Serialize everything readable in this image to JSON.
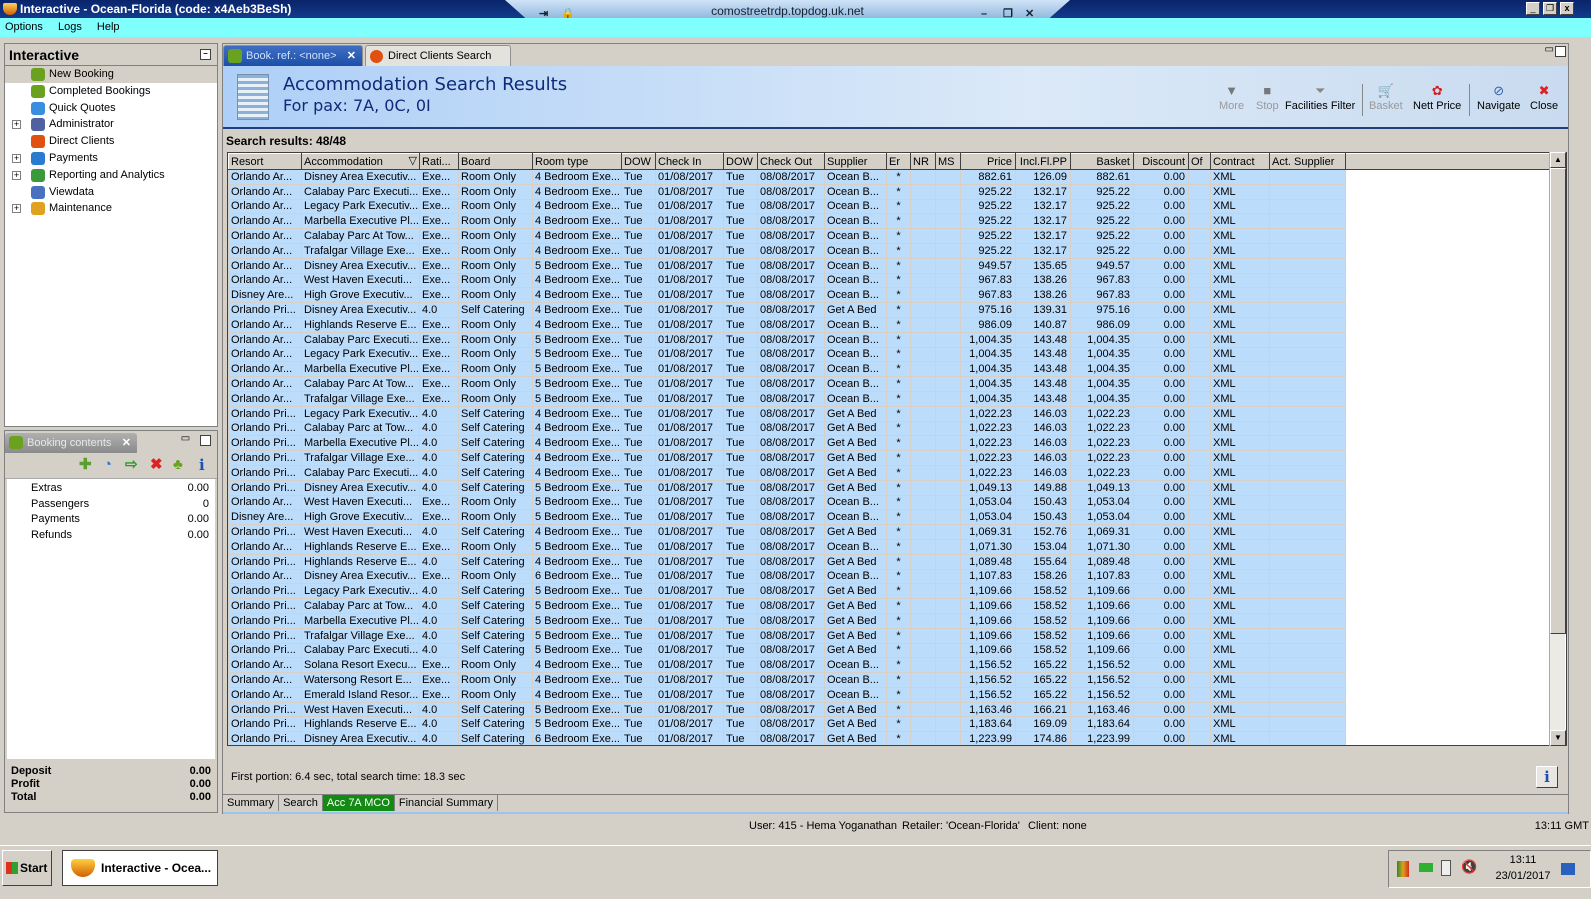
{
  "window": {
    "title": "Interactive - Ocean-Florida (code: x4Aeb3BeSh)",
    "rdp_host": "comostreetrdp.topdog.uk.net"
  },
  "menu": [
    "Options",
    "Logs",
    "Help"
  ],
  "nav": {
    "title": "Interactive",
    "items": [
      {
        "label": "New Booking",
        "expandable": false,
        "icon": "palm-tree-icon",
        "color": "#6aa220"
      },
      {
        "label": "Completed Bookings",
        "expandable": false,
        "icon": "palm-money-icon",
        "color": "#6aa220"
      },
      {
        "label": "Quick Quotes",
        "expandable": false,
        "icon": "clock-icon",
        "color": "#3a8ee0"
      },
      {
        "label": "Administrator",
        "expandable": true,
        "icon": "runner-icon",
        "color": "#5060a0"
      },
      {
        "label": "Direct Clients",
        "expandable": false,
        "icon": "client-icon",
        "color": "#e05010"
      },
      {
        "label": "Payments",
        "expandable": true,
        "icon": "payment-icon",
        "color": "#2a7ad0"
      },
      {
        "label": "Reporting and Analytics",
        "expandable": true,
        "icon": "report-icon",
        "color": "#3a9a3a"
      },
      {
        "label": "Viewdata",
        "expandable": false,
        "icon": "globe-icon",
        "color": "#4a70c0"
      },
      {
        "label": "Maintenance",
        "expandable": true,
        "icon": "maintenance-icon",
        "color": "#e0a020"
      }
    ]
  },
  "booking_contents": {
    "title": "Booking contents",
    "rows": [
      {
        "label": "Extras",
        "value": "0.00"
      },
      {
        "label": "Passengers",
        "value": "0"
      },
      {
        "label": "Payments",
        "value": "0.00"
      },
      {
        "label": "Refunds",
        "value": "0.00"
      }
    ],
    "totals": [
      {
        "label": "Deposit",
        "value": "0.00"
      },
      {
        "label": "Profit",
        "value": "0.00"
      },
      {
        "label": "Total",
        "value": "0.00"
      }
    ]
  },
  "tabs": [
    {
      "label": "Book. ref.: <none>"
    },
    {
      "label": "Direct Clients Search"
    }
  ],
  "header": {
    "title": "Accommodation Search Results",
    "subtitle": "For pax: 7A, 0C, 0I"
  },
  "toolbar": [
    {
      "label": "More",
      "icon": "more-icon",
      "glyph": "▼",
      "disabled": true
    },
    {
      "label": "Stop",
      "icon": "stop-icon",
      "glyph": "■",
      "disabled": true
    },
    {
      "label": "Facilities Filter",
      "icon": "funnel-icon",
      "glyph": "⏷",
      "disabled": false
    },
    {
      "label": "Basket",
      "icon": "basket-icon",
      "glyph": "🛒",
      "disabled": true
    },
    {
      "label": "Nett Price",
      "icon": "nett-price-icon",
      "glyph": "✿",
      "disabled": false
    },
    {
      "label": "Navigate",
      "icon": "compass-icon",
      "glyph": "⊘",
      "disabled": false
    },
    {
      "label": "Close",
      "icon": "close-icon",
      "glyph": "✖",
      "disabled": false
    }
  ],
  "search_results": "Search results: 48/48",
  "grid": {
    "columns": [
      "Resort",
      "Accommodation",
      "Rati...",
      "Board",
      "Room type",
      "DOW",
      "Check In",
      "DOW",
      "Check Out",
      "Supplier",
      "Er",
      "NR",
      "MS",
      "Price",
      "Incl.Fl.PP",
      "Basket",
      "Discount",
      "Of",
      "Contract",
      "Act. Supplier"
    ],
    "rows": [
      [
        "Orlando Ar...",
        "Disney Area Executiv...",
        "Exe...",
        "Room Only",
        "4 Bedroom Exe...",
        "Tue",
        "01/08/2017",
        "Tue",
        "08/08/2017",
        "Ocean B...",
        "*",
        "",
        "",
        "882.61",
        "126.09",
        "882.61",
        "0.00",
        "",
        "XML",
        ""
      ],
      [
        "Orlando Ar...",
        "Calabay Parc Executi...",
        "Exe...",
        "Room Only",
        "4 Bedroom Exe...",
        "Tue",
        "01/08/2017",
        "Tue",
        "08/08/2017",
        "Ocean B...",
        "*",
        "",
        "",
        "925.22",
        "132.17",
        "925.22",
        "0.00",
        "",
        "XML",
        ""
      ],
      [
        "Orlando Ar...",
        "Legacy Park Executiv...",
        "Exe...",
        "Room Only",
        "4 Bedroom Exe...",
        "Tue",
        "01/08/2017",
        "Tue",
        "08/08/2017",
        "Ocean B...",
        "*",
        "",
        "",
        "925.22",
        "132.17",
        "925.22",
        "0.00",
        "",
        "XML",
        ""
      ],
      [
        "Orlando Ar...",
        "Marbella Executive Pl...",
        "Exe...",
        "Room Only",
        "4 Bedroom Exe...",
        "Tue",
        "01/08/2017",
        "Tue",
        "08/08/2017",
        "Ocean B...",
        "*",
        "",
        "",
        "925.22",
        "132.17",
        "925.22",
        "0.00",
        "",
        "XML",
        ""
      ],
      [
        "Orlando Ar...",
        "Calabay Parc At Tow...",
        "Exe...",
        "Room Only",
        "4 Bedroom Exe...",
        "Tue",
        "01/08/2017",
        "Tue",
        "08/08/2017",
        "Ocean B...",
        "*",
        "",
        "",
        "925.22",
        "132.17",
        "925.22",
        "0.00",
        "",
        "XML",
        ""
      ],
      [
        "Orlando Ar...",
        "Trafalgar Village Exe...",
        "Exe...",
        "Room Only",
        "4 Bedroom Exe...",
        "Tue",
        "01/08/2017",
        "Tue",
        "08/08/2017",
        "Ocean B...",
        "*",
        "",
        "",
        "925.22",
        "132.17",
        "925.22",
        "0.00",
        "",
        "XML",
        ""
      ],
      [
        "Orlando Ar...",
        "Disney Area Executiv...",
        "Exe...",
        "Room Only",
        "5 Bedroom Exe...",
        "Tue",
        "01/08/2017",
        "Tue",
        "08/08/2017",
        "Ocean B...",
        "*",
        "",
        "",
        "949.57",
        "135.65",
        "949.57",
        "0.00",
        "",
        "XML",
        ""
      ],
      [
        "Orlando Ar...",
        "West Haven Executi...",
        "Exe...",
        "Room Only",
        "4 Bedroom Exe...",
        "Tue",
        "01/08/2017",
        "Tue",
        "08/08/2017",
        "Ocean B...",
        "*",
        "",
        "",
        "967.83",
        "138.26",
        "967.83",
        "0.00",
        "",
        "XML",
        ""
      ],
      [
        "Disney Are...",
        "High Grove Executiv...",
        "Exe...",
        "Room Only",
        "4 Bedroom Exe...",
        "Tue",
        "01/08/2017",
        "Tue",
        "08/08/2017",
        "Ocean B...",
        "*",
        "",
        "",
        "967.83",
        "138.26",
        "967.83",
        "0.00",
        "",
        "XML",
        ""
      ],
      [
        "Orlando Pri...",
        "Disney Area Executiv...",
        "4.0",
        "Self Catering",
        "4 Bedroom Exe...",
        "Tue",
        "01/08/2017",
        "Tue",
        "08/08/2017",
        "Get A Bed",
        "*",
        "",
        "",
        "975.16",
        "139.31",
        "975.16",
        "0.00",
        "",
        "XML",
        ""
      ],
      [
        "Orlando Ar...",
        "Highlands Reserve E...",
        "Exe...",
        "Room Only",
        "4 Bedroom Exe...",
        "Tue",
        "01/08/2017",
        "Tue",
        "08/08/2017",
        "Ocean B...",
        "*",
        "",
        "",
        "986.09",
        "140.87",
        "986.09",
        "0.00",
        "",
        "XML",
        ""
      ],
      [
        "Orlando Ar...",
        "Calabay Parc Executi...",
        "Exe...",
        "Room Only",
        "5 Bedroom Exe...",
        "Tue",
        "01/08/2017",
        "Tue",
        "08/08/2017",
        "Ocean B...",
        "*",
        "",
        "",
        "1,004.35",
        "143.48",
        "1,004.35",
        "0.00",
        "",
        "XML",
        ""
      ],
      [
        "Orlando Ar...",
        "Legacy Park Executiv...",
        "Exe...",
        "Room Only",
        "5 Bedroom Exe...",
        "Tue",
        "01/08/2017",
        "Tue",
        "08/08/2017",
        "Ocean B...",
        "*",
        "",
        "",
        "1,004.35",
        "143.48",
        "1,004.35",
        "0.00",
        "",
        "XML",
        ""
      ],
      [
        "Orlando Ar...",
        "Marbella Executive Pl...",
        "Exe...",
        "Room Only",
        "5 Bedroom Exe...",
        "Tue",
        "01/08/2017",
        "Tue",
        "08/08/2017",
        "Ocean B...",
        "*",
        "",
        "",
        "1,004.35",
        "143.48",
        "1,004.35",
        "0.00",
        "",
        "XML",
        ""
      ],
      [
        "Orlando Ar...",
        "Calabay Parc At Tow...",
        "Exe...",
        "Room Only",
        "5 Bedroom Exe...",
        "Tue",
        "01/08/2017",
        "Tue",
        "08/08/2017",
        "Ocean B...",
        "*",
        "",
        "",
        "1,004.35",
        "143.48",
        "1,004.35",
        "0.00",
        "",
        "XML",
        ""
      ],
      [
        "Orlando Ar...",
        "Trafalgar Village Exe...",
        "Exe...",
        "Room Only",
        "5 Bedroom Exe...",
        "Tue",
        "01/08/2017",
        "Tue",
        "08/08/2017",
        "Ocean B...",
        "*",
        "",
        "",
        "1,004.35",
        "143.48",
        "1,004.35",
        "0.00",
        "",
        "XML",
        ""
      ],
      [
        "Orlando Pri...",
        "Legacy Park Executiv...",
        "4.0",
        "Self Catering",
        "4 Bedroom Exe...",
        "Tue",
        "01/08/2017",
        "Tue",
        "08/08/2017",
        "Get A Bed",
        "*",
        "",
        "",
        "1,022.23",
        "146.03",
        "1,022.23",
        "0.00",
        "",
        "XML",
        ""
      ],
      [
        "Orlando Pri...",
        "Calabay Parc at Tow...",
        "4.0",
        "Self Catering",
        "4 Bedroom Exe...",
        "Tue",
        "01/08/2017",
        "Tue",
        "08/08/2017",
        "Get A Bed",
        "*",
        "",
        "",
        "1,022.23",
        "146.03",
        "1,022.23",
        "0.00",
        "",
        "XML",
        ""
      ],
      [
        "Orlando Pri...",
        "Marbella Executive Pl...",
        "4.0",
        "Self Catering",
        "4 Bedroom Exe...",
        "Tue",
        "01/08/2017",
        "Tue",
        "08/08/2017",
        "Get A Bed",
        "*",
        "",
        "",
        "1,022.23",
        "146.03",
        "1,022.23",
        "0.00",
        "",
        "XML",
        ""
      ],
      [
        "Orlando Pri...",
        "Trafalgar Village Exe...",
        "4.0",
        "Self Catering",
        "4 Bedroom Exe...",
        "Tue",
        "01/08/2017",
        "Tue",
        "08/08/2017",
        "Get A Bed",
        "*",
        "",
        "",
        "1,022.23",
        "146.03",
        "1,022.23",
        "0.00",
        "",
        "XML",
        ""
      ],
      [
        "Orlando Pri...",
        "Calabay Parc Executi...",
        "4.0",
        "Self Catering",
        "4 Bedroom Exe...",
        "Tue",
        "01/08/2017",
        "Tue",
        "08/08/2017",
        "Get A Bed",
        "*",
        "",
        "",
        "1,022.23",
        "146.03",
        "1,022.23",
        "0.00",
        "",
        "XML",
        ""
      ],
      [
        "Orlando Pri...",
        "Disney Area Executiv...",
        "4.0",
        "Self Catering",
        "5 Bedroom Exe...",
        "Tue",
        "01/08/2017",
        "Tue",
        "08/08/2017",
        "Get A Bed",
        "*",
        "",
        "",
        "1,049.13",
        "149.88",
        "1,049.13",
        "0.00",
        "",
        "XML",
        ""
      ],
      [
        "Orlando Ar...",
        "West Haven Executi...",
        "Exe...",
        "Room Only",
        "5 Bedroom Exe...",
        "Tue",
        "01/08/2017",
        "Tue",
        "08/08/2017",
        "Ocean B...",
        "*",
        "",
        "",
        "1,053.04",
        "150.43",
        "1,053.04",
        "0.00",
        "",
        "XML",
        ""
      ],
      [
        "Disney Are...",
        "High Grove Executiv...",
        "Exe...",
        "Room Only",
        "5 Bedroom Exe...",
        "Tue",
        "01/08/2017",
        "Tue",
        "08/08/2017",
        "Ocean B...",
        "*",
        "",
        "",
        "1,053.04",
        "150.43",
        "1,053.04",
        "0.00",
        "",
        "XML",
        ""
      ],
      [
        "Orlando Pri...",
        "West Haven Executi...",
        "4.0",
        "Self Catering",
        "4 Bedroom Exe...",
        "Tue",
        "01/08/2017",
        "Tue",
        "08/08/2017",
        "Get A Bed",
        "*",
        "",
        "",
        "1,069.31",
        "152.76",
        "1,069.31",
        "0.00",
        "",
        "XML",
        ""
      ],
      [
        "Orlando Ar...",
        "Highlands Reserve E...",
        "Exe...",
        "Room Only",
        "5 Bedroom Exe...",
        "Tue",
        "01/08/2017",
        "Tue",
        "08/08/2017",
        "Ocean B...",
        "*",
        "",
        "",
        "1,071.30",
        "153.04",
        "1,071.30",
        "0.00",
        "",
        "XML",
        ""
      ],
      [
        "Orlando Pri...",
        "Highlands Reserve E...",
        "4.0",
        "Self Catering",
        "4 Bedroom Exe...",
        "Tue",
        "01/08/2017",
        "Tue",
        "08/08/2017",
        "Get A Bed",
        "*",
        "",
        "",
        "1,089.48",
        "155.64",
        "1,089.48",
        "0.00",
        "",
        "XML",
        ""
      ],
      [
        "Orlando Ar...",
        "Disney Area Executiv...",
        "Exe...",
        "Room Only",
        "6 Bedroom Exe...",
        "Tue",
        "01/08/2017",
        "Tue",
        "08/08/2017",
        "Ocean B...",
        "*",
        "",
        "",
        "1,107.83",
        "158.26",
        "1,107.83",
        "0.00",
        "",
        "XML",
        ""
      ],
      [
        "Orlando Pri...",
        "Legacy Park Executiv...",
        "4.0",
        "Self Catering",
        "5 Bedroom Exe...",
        "Tue",
        "01/08/2017",
        "Tue",
        "08/08/2017",
        "Get A Bed",
        "*",
        "",
        "",
        "1,109.66",
        "158.52",
        "1,109.66",
        "0.00",
        "",
        "XML",
        ""
      ],
      [
        "Orlando Pri...",
        "Calabay Parc at Tow...",
        "4.0",
        "Self Catering",
        "5 Bedroom Exe...",
        "Tue",
        "01/08/2017",
        "Tue",
        "08/08/2017",
        "Get A Bed",
        "*",
        "",
        "",
        "1,109.66",
        "158.52",
        "1,109.66",
        "0.00",
        "",
        "XML",
        ""
      ],
      [
        "Orlando Pri...",
        "Marbella Executive Pl...",
        "4.0",
        "Self Catering",
        "5 Bedroom Exe...",
        "Tue",
        "01/08/2017",
        "Tue",
        "08/08/2017",
        "Get A Bed",
        "*",
        "",
        "",
        "1,109.66",
        "158.52",
        "1,109.66",
        "0.00",
        "",
        "XML",
        ""
      ],
      [
        "Orlando Pri...",
        "Trafalgar Village Exe...",
        "4.0",
        "Self Catering",
        "5 Bedroom Exe...",
        "Tue",
        "01/08/2017",
        "Tue",
        "08/08/2017",
        "Get A Bed",
        "*",
        "",
        "",
        "1,109.66",
        "158.52",
        "1,109.66",
        "0.00",
        "",
        "XML",
        ""
      ],
      [
        "Orlando Pri...",
        "Calabay Parc Executi...",
        "4.0",
        "Self Catering",
        "5 Bedroom Exe...",
        "Tue",
        "01/08/2017",
        "Tue",
        "08/08/2017",
        "Get A Bed",
        "*",
        "",
        "",
        "1,109.66",
        "158.52",
        "1,109.66",
        "0.00",
        "",
        "XML",
        ""
      ],
      [
        "Orlando Ar...",
        "Solana Resort Execu...",
        "Exe...",
        "Room Only",
        "4 Bedroom Exe...",
        "Tue",
        "01/08/2017",
        "Tue",
        "08/08/2017",
        "Ocean B...",
        "*",
        "",
        "",
        "1,156.52",
        "165.22",
        "1,156.52",
        "0.00",
        "",
        "XML",
        ""
      ],
      [
        "Orlando Ar...",
        "Watersong Resort E...",
        "Exe...",
        "Room Only",
        "4 Bedroom Exe...",
        "Tue",
        "01/08/2017",
        "Tue",
        "08/08/2017",
        "Ocean B...",
        "*",
        "",
        "",
        "1,156.52",
        "165.22",
        "1,156.52",
        "0.00",
        "",
        "XML",
        ""
      ],
      [
        "Orlando Ar...",
        "Emerald Island Resor...",
        "Exe...",
        "Room Only",
        "4 Bedroom Exe...",
        "Tue",
        "01/08/2017",
        "Tue",
        "08/08/2017",
        "Ocean B...",
        "*",
        "",
        "",
        "1,156.52",
        "165.22",
        "1,156.52",
        "0.00",
        "",
        "XML",
        ""
      ],
      [
        "Orlando Pri...",
        "West Haven Executi...",
        "4.0",
        "Self Catering",
        "5 Bedroom Exe...",
        "Tue",
        "01/08/2017",
        "Tue",
        "08/08/2017",
        "Get A Bed",
        "*",
        "",
        "",
        "1,163.46",
        "166.21",
        "1,163.46",
        "0.00",
        "",
        "XML",
        ""
      ],
      [
        "Orlando Pri...",
        "Highlands Reserve E...",
        "4.0",
        "Self Catering",
        "5 Bedroom Exe...",
        "Tue",
        "01/08/2017",
        "Tue",
        "08/08/2017",
        "Get A Bed",
        "*",
        "",
        "",
        "1,183.64",
        "169.09",
        "1,183.64",
        "0.00",
        "",
        "XML",
        ""
      ],
      [
        "Orlando Pri...",
        "Disney Area Executiv...",
        "4.0",
        "Self Catering",
        "6 Bedroom Exe...",
        "Tue",
        "01/08/2017",
        "Tue",
        "08/08/2017",
        "Get A Bed",
        "*",
        "",
        "",
        "1,223.99",
        "174.86",
        "1,223.99",
        "0.00",
        "",
        "XML",
        ""
      ]
    ]
  },
  "timing": "First portion: 6.4 sec, total search time: 18.3 sec",
  "info_button": "i",
  "bottom_tabs": [
    {
      "label": "Summary"
    },
    {
      "label": "Search"
    },
    {
      "label": "Acc 7A MCO",
      "active": true
    },
    {
      "label": "Financial Summary"
    }
  ],
  "status": {
    "user": "User: 415 - Hema Yoganathan",
    "retailer": "Retailer: 'Ocean-Florida'",
    "client": "Client: none",
    "time": "13:11 GMT"
  },
  "taskbar": {
    "start": "Start",
    "app": "Interactive - Ocea...",
    "clock_time": "13:11",
    "clock_date": "23/01/2017"
  },
  "colors": {
    "row_bg": "#bcdcfc",
    "active_tab": "#138a13",
    "menu_bg": "#80ffff",
    "title_text": "#0f2a78"
  }
}
